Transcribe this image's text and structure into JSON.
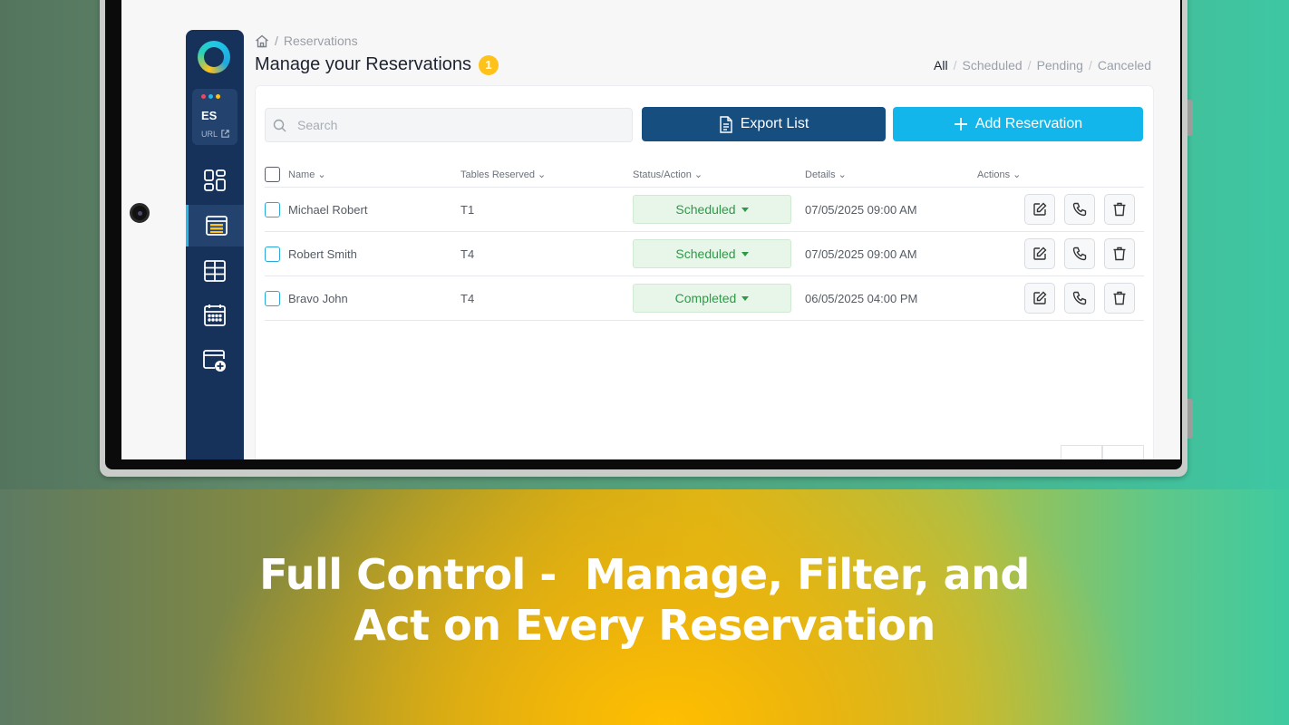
{
  "sidebar": {
    "org_abbr": "ES",
    "org_url_label": "URL",
    "dot_colors": [
      "#e84a5f",
      "#29b6e8",
      "#ffc21a"
    ],
    "nav": [
      {
        "icon": "dashboard-icon",
        "active": false
      },
      {
        "icon": "reservations-icon",
        "active": true
      },
      {
        "icon": "tables-icon",
        "active": false
      },
      {
        "icon": "calendar-icon",
        "active": false
      },
      {
        "icon": "add-window-icon",
        "active": false
      }
    ]
  },
  "breadcrumb": {
    "home_icon": "home-icon",
    "separator": "/",
    "current": "Reservations"
  },
  "header": {
    "title": "Manage your Reservations",
    "badge_count": "1"
  },
  "filters": {
    "all": "All",
    "scheduled": "Scheduled",
    "pending": "Pending",
    "canceled": "Canceled",
    "separator": "/"
  },
  "toolbar": {
    "search_placeholder": "Search",
    "export_label": "Export List",
    "add_label": "Add Reservation"
  },
  "table": {
    "columns": [
      "Name",
      "Tables Reserved",
      "Status/Action",
      "Details",
      "Actions"
    ],
    "rows": [
      {
        "name": "Michael Robert",
        "table": "T1",
        "status": "Scheduled",
        "details": "07/05/2025 09:00 AM"
      },
      {
        "name": "Robert Smith",
        "table": "T4",
        "status": "Scheduled",
        "details": "07/05/2025 09:00 AM"
      },
      {
        "name": "Bravo John",
        "table": "T4",
        "status": "Completed",
        "details": "06/05/2025 04:00 PM"
      }
    ]
  },
  "headline": {
    "line1": "Full Control -  Manage, Filter, and",
    "line2": "Act on Every Reservation"
  },
  "colors": {
    "sidebar": "#16325a",
    "export_button": "#164e80",
    "add_button": "#13b6ea",
    "badge": "#ffc21a",
    "status_text": "#2d9a47"
  }
}
